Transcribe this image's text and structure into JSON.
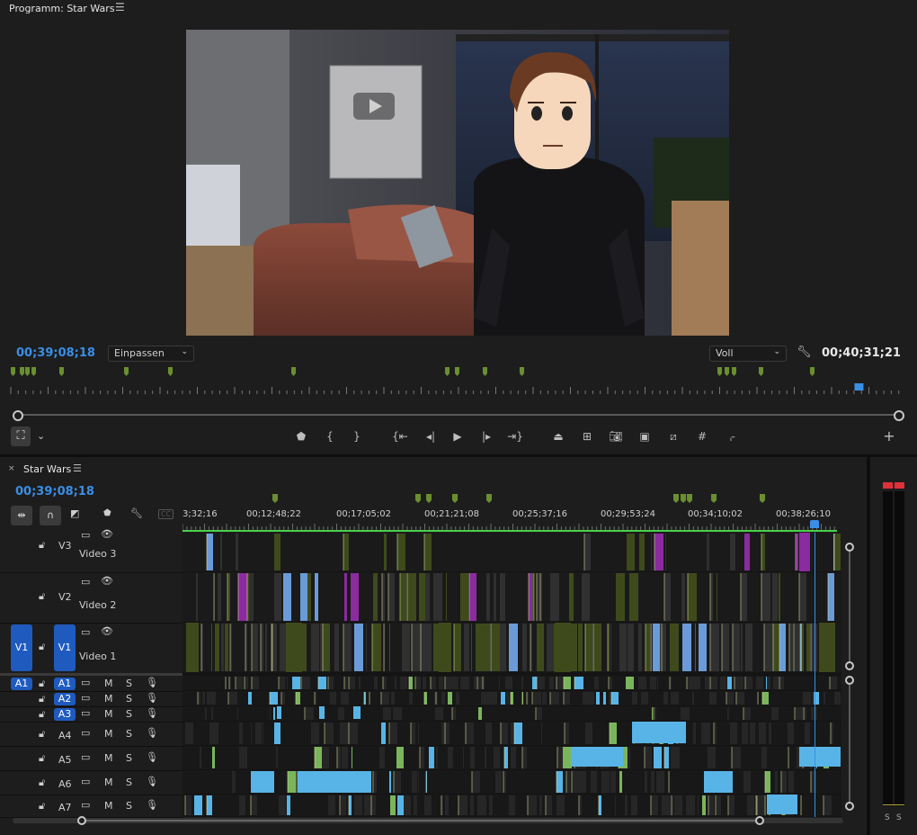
{
  "program_monitor": {
    "title": "Programm: Star Wars",
    "menu_icon": "hamburger-icon",
    "current_timecode": "00;39;08;18",
    "fit_dropdown": "Einpassen",
    "quality_dropdown": "Voll",
    "duration_timecode": "00;40;31;21",
    "scrub_fraction": 0.955
  },
  "timeline": {
    "tab_title": "Star Wars",
    "current_timecode": "00;39;08;18",
    "ruler_labels": [
      "3;32;16",
      "00;12;48;22",
      "00;17;05;02",
      "00;21;21;08",
      "00;25;37;16",
      "00;29;53;24",
      "00;34;10;02",
      "00;38;26;10"
    ],
    "video_tracks": [
      {
        "id": "V3",
        "name": "Video 3"
      },
      {
        "id": "V2",
        "name": "Video 2"
      },
      {
        "id": "V1",
        "name": "Video 1",
        "source_patch": "V1"
      }
    ],
    "audio_tracks": [
      {
        "id": "A1",
        "source_patch": "A1"
      },
      {
        "id": "A2"
      },
      {
        "id": "A3"
      },
      {
        "id": "A4"
      },
      {
        "id": "A5"
      },
      {
        "id": "A6"
      },
      {
        "id": "A7"
      }
    ],
    "mute_label": "M",
    "solo_label": "S"
  },
  "audio_meter": {
    "solo_labels": [
      "S",
      "S"
    ]
  },
  "colors": {
    "accent_blue": "#3a8ee6",
    "patch_blue": "#1f5bbf",
    "marker_green": "#6a8f2f",
    "video_clip_green": "#3f4a1c",
    "audio_clip_blue": "#58b4e6",
    "magenta_clip": "#8c2aa0",
    "meter_peak_red": "#e0303a"
  }
}
